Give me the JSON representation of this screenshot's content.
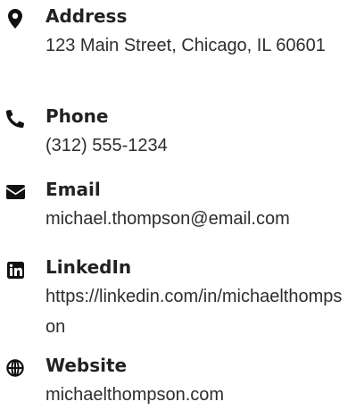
{
  "contacts": [
    {
      "label": "Address",
      "value": "123 Main Street, Chicago, IL 60601",
      "icon": "map-marker-icon"
    },
    {
      "label": "Phone",
      "value": "(312) 555-1234",
      "icon": "phone-icon"
    },
    {
      "label": "Email",
      "value": "michael.thompson@email.com",
      "icon": "envelope-icon"
    },
    {
      "label": "LinkedIn",
      "value": "https://linkedin.com/in/michaelthompson",
      "icon": "linkedin-icon"
    },
    {
      "label": "Website",
      "value": "michaelthompson.com",
      "icon": "globe-icon"
    }
  ],
  "colors": {
    "text": "#2d2d2d",
    "label": "#222222",
    "icon": "#111111",
    "background": "#ffffff"
  }
}
